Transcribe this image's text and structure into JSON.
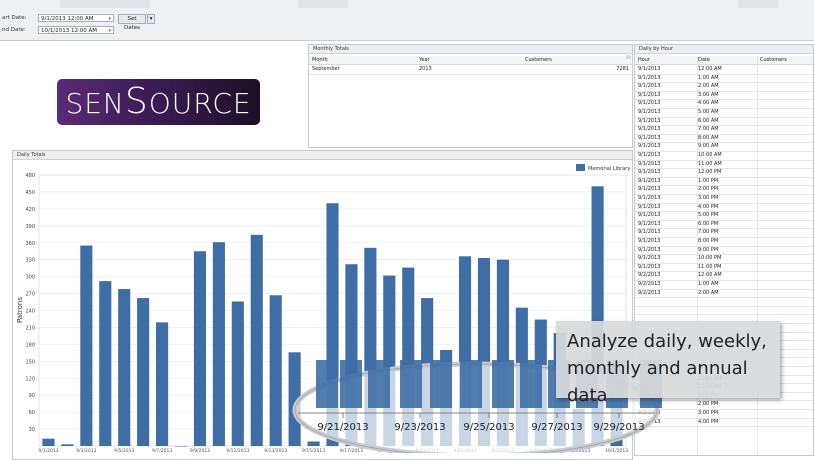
{
  "toolbar": {
    "start_date_label": "art Date:",
    "start_date_value": "9/1/2013 12:00 AM",
    "end_date_label": "nd Date:",
    "end_date_value": "10/1/2013 12:00 AM",
    "set_dates_label": "Set Dates",
    "dropdown_glyph": "▾"
  },
  "logo": {
    "lead": "SEN",
    "s": "S",
    "tail": "OURCE"
  },
  "monthly_totals": {
    "title": "Monthly Totals",
    "columns": [
      "Month",
      "Year",
      "Customers"
    ],
    "rows": [
      [
        "September",
        "2013",
        "7281"
      ]
    ]
  },
  "daily_by_hour": {
    "title": "Daily by Hour",
    "columns": [
      "Hour",
      "Date",
      "Customers"
    ],
    "rows": [
      [
        "9/1/2013",
        "12:00 AM",
        ""
      ],
      [
        "9/1/2013",
        "1:00 AM",
        ""
      ],
      [
        "9/1/2013",
        "2:00 AM",
        ""
      ],
      [
        "9/1/2013",
        "3:00 AM",
        ""
      ],
      [
        "9/1/2013",
        "4:00 AM",
        ""
      ],
      [
        "9/1/2013",
        "5:00 AM",
        ""
      ],
      [
        "9/1/2013",
        "6:00 AM",
        ""
      ],
      [
        "9/1/2013",
        "7:00 AM",
        ""
      ],
      [
        "9/1/2013",
        "8:00 AM",
        ""
      ],
      [
        "9/1/2013",
        "9:00 AM",
        ""
      ],
      [
        "9/1/2013",
        "10:00 AM",
        ""
      ],
      [
        "9/1/2013",
        "11:00 AM",
        ""
      ],
      [
        "9/1/2013",
        "12:00 PM",
        ""
      ],
      [
        "9/1/2013",
        "1:00 PM",
        ""
      ],
      [
        "9/1/2013",
        "2:00 PM",
        ""
      ],
      [
        "9/1/2013",
        "3:00 PM",
        ""
      ],
      [
        "9/1/2013",
        "4:00 PM",
        ""
      ],
      [
        "9/1/2013",
        "5:00 PM",
        ""
      ],
      [
        "9/1/2013",
        "6:00 PM",
        ""
      ],
      [
        "9/1/2013",
        "7:00 PM",
        ""
      ],
      [
        "9/1/2013",
        "8:00 PM",
        ""
      ],
      [
        "9/1/2013",
        "9:00 PM",
        ""
      ],
      [
        "9/1/2013",
        "10:00 PM",
        ""
      ],
      [
        "9/1/2013",
        "11:00 PM",
        ""
      ],
      [
        "9/2/2013",
        "12:00 AM",
        ""
      ],
      [
        "9/2/2013",
        "1:00 AM",
        ""
      ],
      [
        "9/2/2013",
        "2:00 AM",
        ""
      ],
      [
        "",
        "",
        ""
      ],
      [
        "",
        "",
        ""
      ],
      [
        "",
        "",
        ""
      ],
      [
        "",
        "",
        ""
      ],
      [
        "",
        "",
        ""
      ],
      [
        "",
        "",
        ""
      ],
      [
        "",
        "",
        ""
      ],
      [
        "",
        "",
        ""
      ],
      [
        "",
        "",
        ""
      ],
      [
        "9/2/2013",
        "11:00 AM",
        ""
      ],
      [
        "9/2/2013",
        "12:00 PM",
        ""
      ],
      [
        "9/2/2013",
        "1:00 PM",
        ""
      ],
      [
        "9/2/2013",
        "2:00 PM",
        ""
      ],
      [
        "9/2/2013",
        "3:00 PM",
        ""
      ],
      [
        "9/2/2013",
        "4:00 PM",
        ""
      ]
    ]
  },
  "daily_totals": {
    "title": "Daily Totals"
  },
  "chart_data": {
    "type": "bar",
    "ylabel": "Patrons",
    "ylim": [
      0,
      480
    ],
    "yticks": [
      30,
      60,
      90,
      120,
      150,
      180,
      210,
      240,
      270,
      300,
      330,
      360,
      390,
      420,
      450,
      480
    ],
    "legend_position": "top-right",
    "grid": true,
    "series": [
      {
        "name": "Memorial Library",
        "color": "#3e6ea5",
        "values": [
          13,
          3,
          355,
          292,
          278,
          262,
          219,
          0,
          345,
          361,
          256,
          374,
          267,
          166,
          8,
          430,
          322,
          351,
          302,
          316,
          262,
          170,
          336,
          333,
          330,
          245,
          224,
          200,
          66,
          460,
          105
        ]
      }
    ],
    "categories": [
      "9/1/2013",
      "9/2/2013",
      "9/3/2013",
      "9/4/2013",
      "9/5/2013",
      "9/6/2013",
      "9/7/2013",
      "9/8/2013",
      "9/9/2013",
      "9/10/2013",
      "9/11/2013",
      "9/12/2013",
      "9/13/2013",
      "9/14/2013",
      "9/15/2013",
      "9/16/2013",
      "9/17/2013",
      "9/18/2013",
      "9/19/2013",
      "9/20/2013",
      "9/21/2013",
      "9/22/2013",
      "9/23/2013",
      "9/24/2013",
      "9/25/2013",
      "9/26/2013",
      "9/27/2013",
      "9/28/2013",
      "9/29/2013",
      "9/30/2013",
      "10/1/2013"
    ],
    "magnified_labels": [
      "9/21/2013",
      "9/23/2013",
      "9/25/2013",
      "9/27/2013",
      "9/29/2013"
    ]
  },
  "callout": {
    "text": "Analyze daily, weekly, monthly and annual data"
  }
}
